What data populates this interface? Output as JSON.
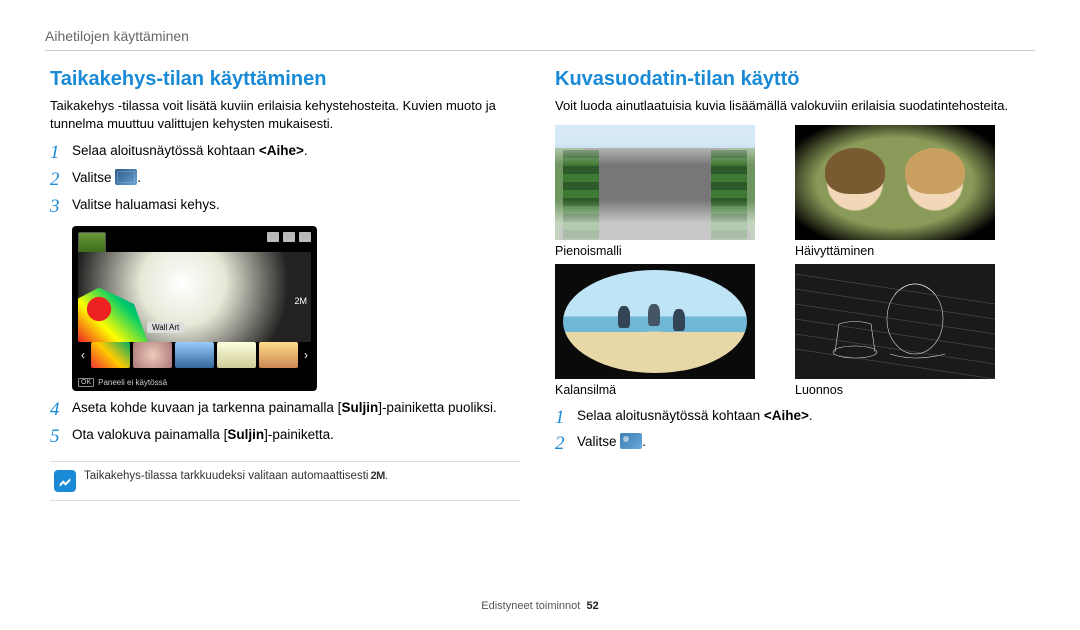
{
  "header": {
    "breadcrumb": "Aihetilojen käyttäminen"
  },
  "left": {
    "title": "Taikakehys-tilan käyttäminen",
    "intro": "Taikakehys -tilassa voit lisätä kuviin erilaisia kehystehosteita. Kuvien muoto ja tunnelma muuttuu valittujen kehysten mukaisesti.",
    "steps": {
      "s1_pre": "Selaa aloitusnäytössä kohtaan ",
      "s1_bold": "<Aihe>",
      "s1_post": ".",
      "s2_pre": "Valitse ",
      "s2_post": ".",
      "s3": "Valitse haluamasi kehys.",
      "s4_pre": "Aseta kohde kuvaan ja tarkenna painamalla [",
      "s4_bold": "Suljin",
      "s4_post": "]-painiketta puoliksi.",
      "s5_pre": "Ota valokuva painamalla [",
      "s5_bold": "Suljin",
      "s5_post": "]-painiketta."
    },
    "camera": {
      "badge_2m": "2M",
      "wall_art": "Wall Art",
      "ok": "OK",
      "panel_off": "Paneeli ei käytössä"
    },
    "note": {
      "text": "Taikakehys-tilassa tarkkuudeksi valitaan automaattisesti ",
      "badge": "2M",
      "post": "."
    }
  },
  "right": {
    "title": "Kuvasuodatin-tilan käyttö",
    "intro": "Voit luoda ainutlaatuisia kuvia lisäämällä valokuviin erilaisia suodatintehosteita.",
    "captions": {
      "mini": "Pienoismalli",
      "vignette": "Häivyttäminen",
      "fisheye": "Kalansilmä",
      "sketch": "Luonnos"
    },
    "steps": {
      "s1_pre": "Selaa aloitusnäytössä kohtaan ",
      "s1_bold": "<Aihe>",
      "s1_post": ".",
      "s2_pre": "Valitse ",
      "s2_post": "."
    }
  },
  "footer": {
    "section": "Edistyneet toiminnot",
    "page": "52"
  }
}
